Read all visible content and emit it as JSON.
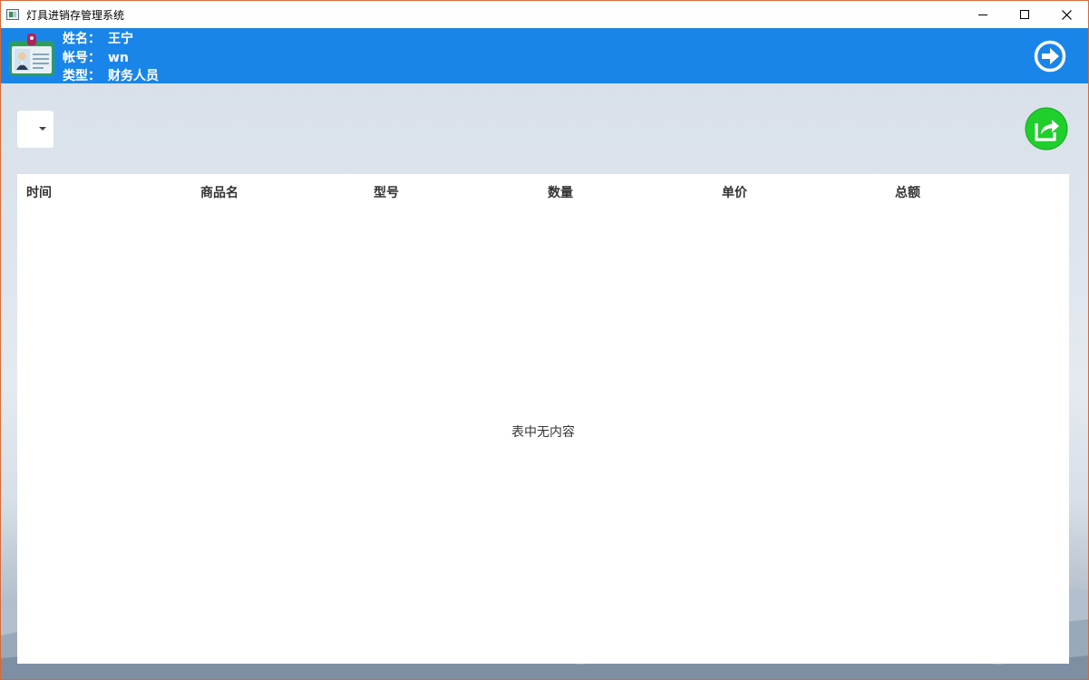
{
  "window": {
    "title": "灯具进销存管理系统"
  },
  "user": {
    "name_label": "姓名：",
    "name_value": "王宁",
    "account_label": "帐号：",
    "account_value": "wn",
    "type_label": "类型：",
    "type_value": "财务人员"
  },
  "icons": {
    "badge": "id-badge-icon",
    "logout": "logout-arrow-icon",
    "export": "export-share-icon",
    "dropdown": "chevron-down-icon"
  },
  "colors": {
    "header_bg": "#1a85e8",
    "export_green": "#1fcf2c",
    "panel_bg": "#ffffff"
  },
  "filter": {
    "selected": ""
  },
  "table": {
    "columns": [
      "时间",
      "商品名",
      "型号",
      "数量",
      "单价",
      "总额"
    ],
    "rows": [],
    "empty_message": "表中无内容"
  }
}
